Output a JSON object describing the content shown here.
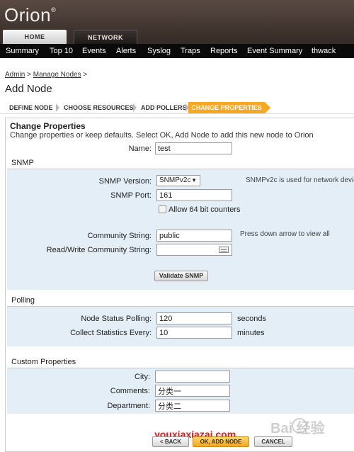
{
  "header": {
    "logo": "Orion",
    "logo_mark": "®",
    "tabs": [
      {
        "label": "HOME"
      },
      {
        "label": "NETWORK"
      }
    ],
    "nav": [
      "Summary",
      "Top 10",
      "Events",
      "Alerts",
      "Syslog",
      "Traps",
      "Reports",
      "Event Summary",
      "thwack"
    ]
  },
  "breadcrumb": {
    "items": [
      "Admin",
      "Manage Nodes"
    ],
    "sep": ">"
  },
  "page_title": "Add Node",
  "wizard": {
    "steps": [
      "DEFINE NODE",
      "CHOOSE RESOURCES",
      "ADD POLLERS",
      "CHANGE PROPERTIES"
    ],
    "active_index": 3,
    "active_color": "#f7a820"
  },
  "form": {
    "title": "Change Properties",
    "subtitle": "Change properties or keep defaults. Select OK, Add Node to add this new node to Orion",
    "name_label": "Name:",
    "name_value": "test",
    "snmp": {
      "section": "SNMP",
      "version_label": "SNMP Version:",
      "version_value": "SNMPv2c",
      "version_hint": "SNMPv2c is used for network devic",
      "port_label": "SNMP Port:",
      "port_value": "161",
      "allow64_label": "Allow 64 bit counters",
      "community_label": "Community String:",
      "community_value": "public",
      "community_hint": "Press down arrow to view all",
      "rw_label": "Read/Write Community String:",
      "rw_value": "",
      "validate_button": "Validate SNMP"
    },
    "polling": {
      "section": "Polling",
      "status_label": "Node Status Polling:",
      "status_value": "120",
      "status_unit": "seconds",
      "collect_label": "Collect Statistics Every:",
      "collect_value": "10",
      "collect_unit": "minutes"
    },
    "custom": {
      "section": "Custom Properties",
      "city_label": "City:",
      "city_value": "",
      "comments_label": "Comments:",
      "comments_value": "分类一",
      "department_label": "Department:",
      "department_value": "分类二"
    }
  },
  "footer": {
    "back": "< BACK",
    "ok": "OK, ADD NODE",
    "cancel": "CANCEL"
  },
  "watermark": "youxiaxiazai.com",
  "baidu_watermark": "Bai  经验"
}
